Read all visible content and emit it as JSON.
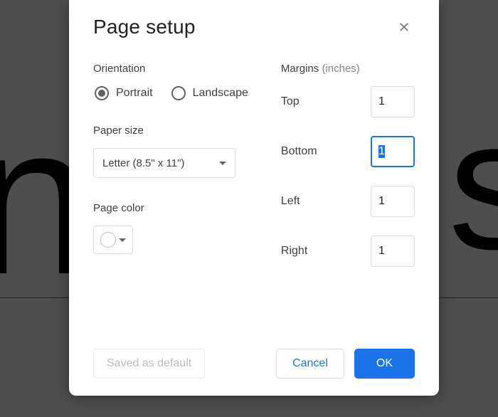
{
  "dialog": {
    "title": "Page setup",
    "close_icon": "close"
  },
  "orientation": {
    "label": "Orientation",
    "options": {
      "portrait": "Portrait",
      "landscape": "Landscape"
    },
    "selected": "portrait"
  },
  "paper_size": {
    "label": "Paper size",
    "selected": "Letter (8.5\" x 11\")"
  },
  "page_color": {
    "label": "Page color",
    "value": "#ffffff"
  },
  "margins": {
    "label": "Margins",
    "unit": "(inches)",
    "top": {
      "label": "Top",
      "value": "1"
    },
    "bottom": {
      "label": "Bottom",
      "value": "1",
      "focused": true
    },
    "left": {
      "label": "Left",
      "value": "1"
    },
    "right": {
      "label": "Right",
      "value": "1"
    }
  },
  "footer": {
    "saved_default": "Saved as default",
    "cancel": "Cancel",
    "ok": "OK"
  }
}
